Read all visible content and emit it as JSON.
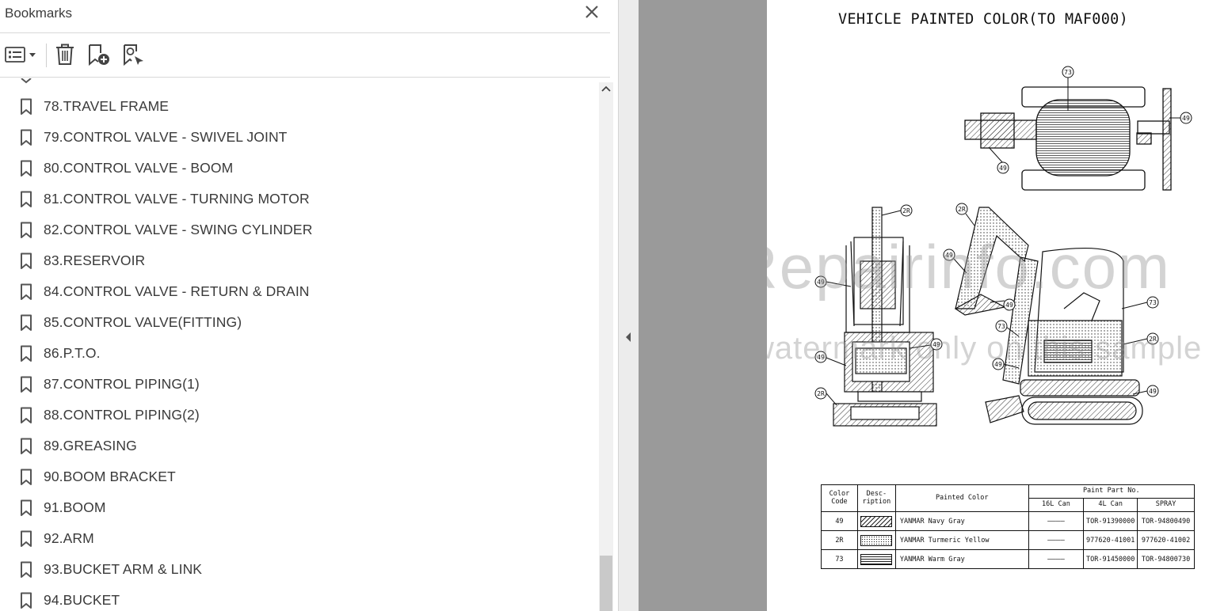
{
  "bookmarks_panel": {
    "title": "Bookmarks",
    "items": [
      {
        "label": "78.TRAVEL FRAME"
      },
      {
        "label": "79.CONTROL VALVE - SWIVEL JOINT"
      },
      {
        "label": "80.CONTROL VALVE - BOOM"
      },
      {
        "label": "81.CONTROL VALVE - TURNING MOTOR"
      },
      {
        "label": "82.CONTROL VALVE - SWING CYLINDER"
      },
      {
        "label": "83.RESERVOIR"
      },
      {
        "label": "84.CONTROL VALVE - RETURN & DRAIN"
      },
      {
        "label": "85.CONTROL VALVE(FITTING)"
      },
      {
        "label": "86.P.T.O."
      },
      {
        "label": "87.CONTROL PIPING(1)"
      },
      {
        "label": "88.CONTROL PIPING(2)"
      },
      {
        "label": "89.GREASING"
      },
      {
        "label": "90.BOOM BRACKET"
      },
      {
        "label": "91.BOOM"
      },
      {
        "label": "92.ARM"
      },
      {
        "label": "93.BUCKET ARM & LINK"
      },
      {
        "label": "94.BUCKET"
      }
    ]
  },
  "toolbar": {
    "icons": [
      "bookmark-options-icon",
      "delete-icon",
      "new-bookmark-icon",
      "find-bookmark-icon"
    ]
  },
  "document": {
    "title": "VEHICLE PAINTED COLOR(TO MAF000)",
    "callouts": [
      "73",
      "49",
      "49",
      "2R",
      "2R",
      "49",
      "49",
      "49",
      "73",
      "73",
      "2R",
      "49",
      "49",
      "49",
      "2R",
      "49"
    ],
    "watermark": {
      "line1": "eRepairinfo.com",
      "line2": "watermark only on this sample"
    },
    "table": {
      "headers": {
        "color_code": "Color Code",
        "description": "Desc- ription",
        "painted_color": "Painted Color",
        "paint_part_no": "Paint Part No.",
        "can_16l": "16L Can",
        "can_4l": "4L Can",
        "spray": "SPRAY"
      },
      "rows": [
        {
          "code": "49",
          "pattern": "diagonal-hatch",
          "color": "YANMAR Navy Gray",
          "can16": "————",
          "can4": "TOR-91390000",
          "spray": "TOR-94800490"
        },
        {
          "code": "2R",
          "pattern": "dotted",
          "color": "YANMAR Turmeric Yellow",
          "can16": "————",
          "can4": "977620-41001",
          "spray": "977620-41002"
        },
        {
          "code": "73",
          "pattern": "horizontal-lines",
          "color": "YANMAR Warm Gray",
          "can16": "————",
          "can4": "TOR-91450000",
          "spray": "TOR-94800730"
        }
      ]
    }
  },
  "colors": {
    "panel_bg": "#ffffff",
    "doc_bg": "#9a9a9a",
    "text": "#3a3a3a",
    "scroll_thumb": "#c9c9c9"
  }
}
